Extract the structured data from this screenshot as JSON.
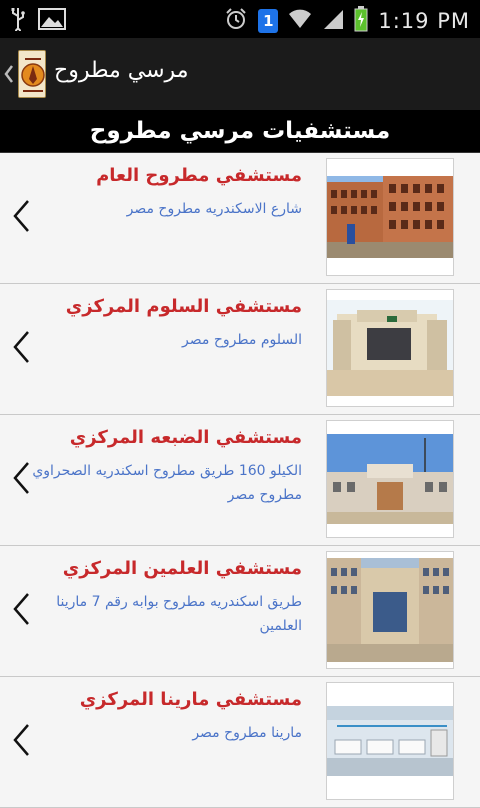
{
  "status_bar": {
    "time": "1:19 PM",
    "notification_count": "1",
    "icons": [
      "usb-icon",
      "image-icon",
      "alarm-icon",
      "notification-badge",
      "wifi-icon",
      "signal-icon",
      "battery-charging-icon"
    ]
  },
  "action_bar": {
    "title": "مرسي مطروح",
    "logo_icon": "app-logo",
    "up_icon": "chevron-left-icon"
  },
  "section": {
    "title": "مستشفيات مرسي مطروح"
  },
  "hospitals": [
    {
      "name": "مستشفي مطروح العام",
      "address": "شارع الاسكندريه مطروح  مصر"
    },
    {
      "name": "مستشفي السلوم المركزي",
      "address": "السلوم مطروح مصر"
    },
    {
      "name": "مستشفي الضبعه المركزي",
      "address": "الكيلو 160 طريق مطروح اسكندريه الصحراوي  مطروح  مصر"
    },
    {
      "name": "مستشفي العلمين المركزي",
      "address": "طريق اسكندريه مطروح بوابه رقم 7 مارينا العلمين"
    },
    {
      "name": "مستشفي مارينا المركزي",
      "address": "مارينا  مطروح  مصر"
    }
  ],
  "colors": {
    "name_red": "#c7292b",
    "address_blue": "#4b74c8",
    "header_black": "#000000",
    "action_bar": "#1b1b1b"
  }
}
